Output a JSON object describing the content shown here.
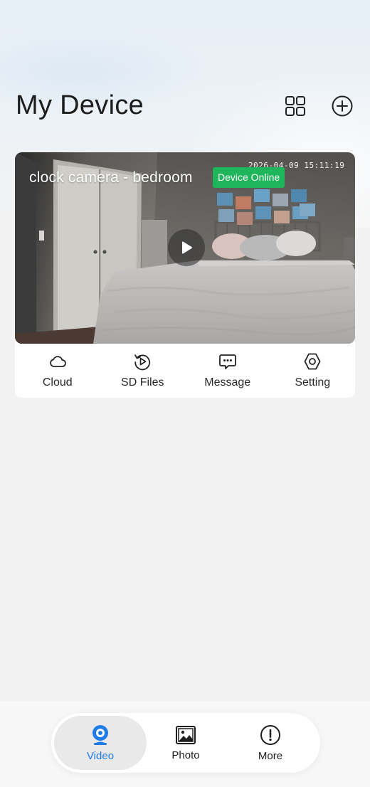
{
  "header": {
    "title": "My Device",
    "grid_icon": "grid-view-icon",
    "add_icon": "add-circle-icon"
  },
  "device": {
    "name": "clock camera - bedroom",
    "status": "Device Online",
    "timestamp": "2026-04-09  15:11:19",
    "play_icon": "play-icon"
  },
  "actions": [
    {
      "label": "Cloud",
      "icon": "cloud-icon"
    },
    {
      "label": "SD Files",
      "icon": "replay-icon"
    },
    {
      "label": "Message",
      "icon": "message-icon"
    },
    {
      "label": "Setting",
      "icon": "settings-icon"
    }
  ],
  "tabs": [
    {
      "label": "Video",
      "icon": "webcam-icon",
      "active": true
    },
    {
      "label": "Photo",
      "icon": "photo-icon",
      "active": false
    },
    {
      "label": "More",
      "icon": "info-icon",
      "active": false
    }
  ],
  "colors": {
    "accent": "#1e7be8",
    "online": "#1fb55a"
  }
}
